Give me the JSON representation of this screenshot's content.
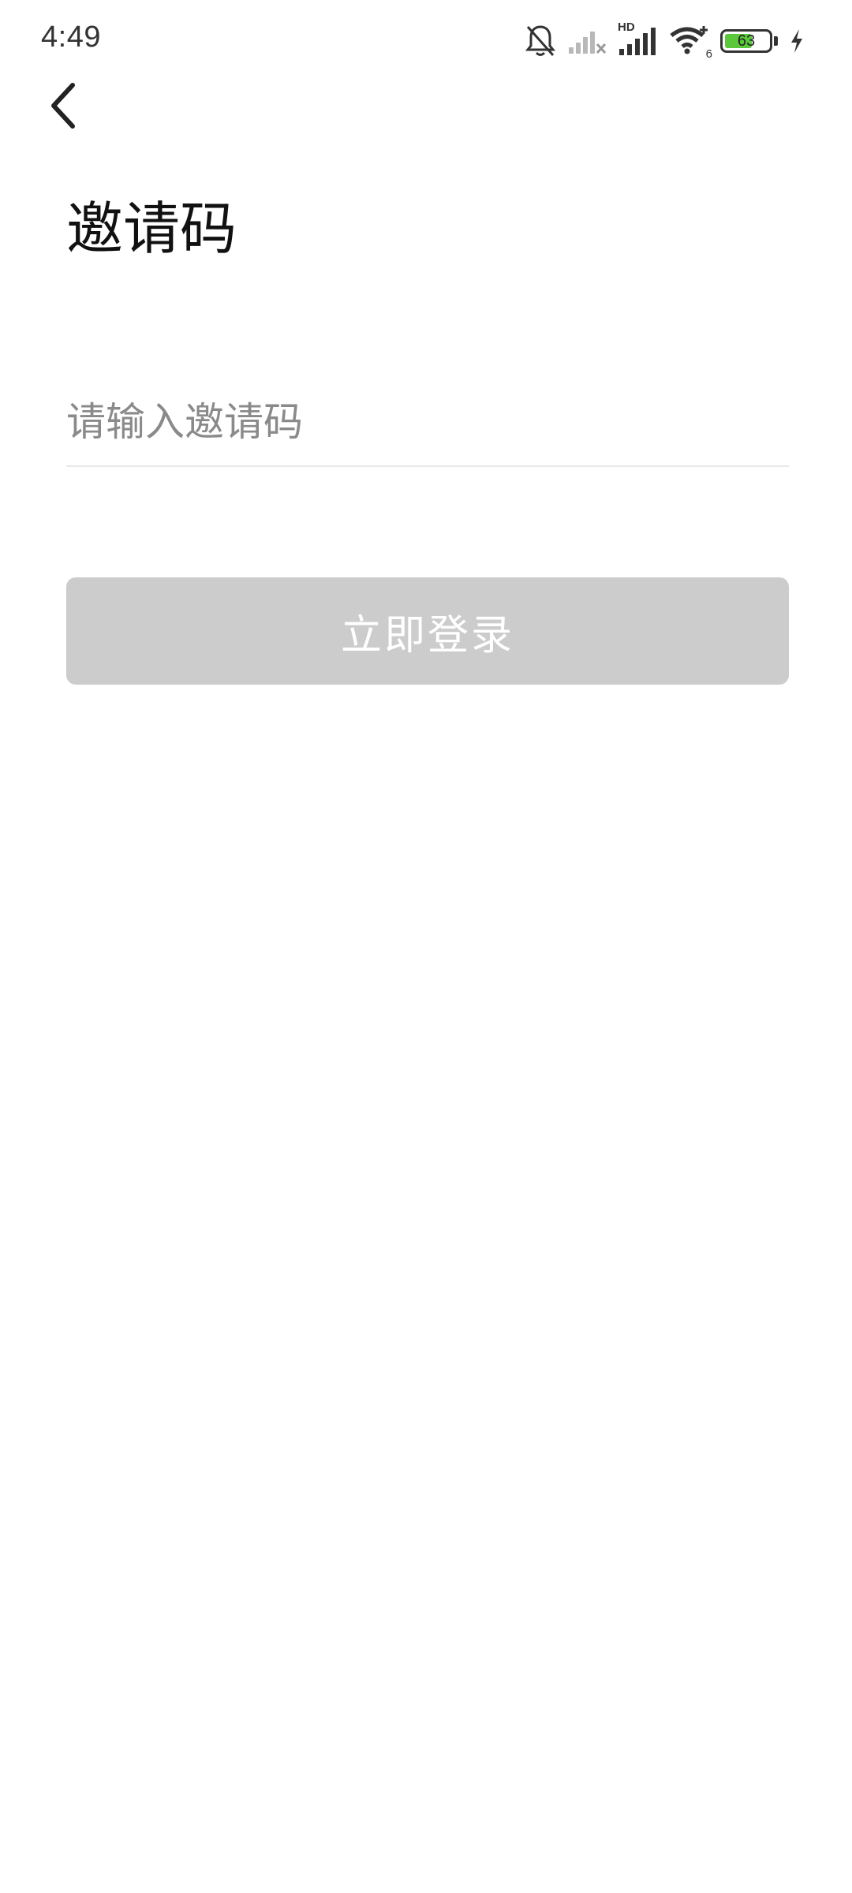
{
  "status_bar": {
    "time": "4:49",
    "battery_percent": "63",
    "battery_level": 0.63,
    "icons": [
      "bell-off-icon",
      "cellular-signal-empty-icon",
      "hd-signal-icon",
      "wifi-icon",
      "battery-icon",
      "charging-icon"
    ],
    "hd_label": "HD",
    "wifi_label": "6"
  },
  "header": {
    "back_icon": "chevron-left-icon",
    "title": "邀请码"
  },
  "form": {
    "invite_placeholder": "请输入邀请码",
    "invite_value": "",
    "submit_label": "立即登录"
  },
  "colors": {
    "button_disabled": "#cccccc",
    "battery_fill": "#5ac83a",
    "divider": "#e8e8e8"
  }
}
